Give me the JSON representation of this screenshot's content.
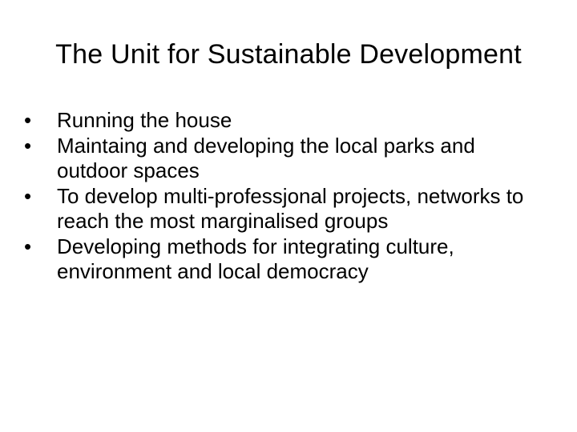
{
  "slide": {
    "title": "The Unit for Sustainable Development",
    "bullet_glyph": "•",
    "bullets": [
      "Running the house",
      "Maintaing and developing the local parks and outdoor spaces",
      "To develop multi-professjonal projects, networks to reach the most marginalised groups",
      "Developing methods for integrating culture, environment and local democracy"
    ]
  }
}
